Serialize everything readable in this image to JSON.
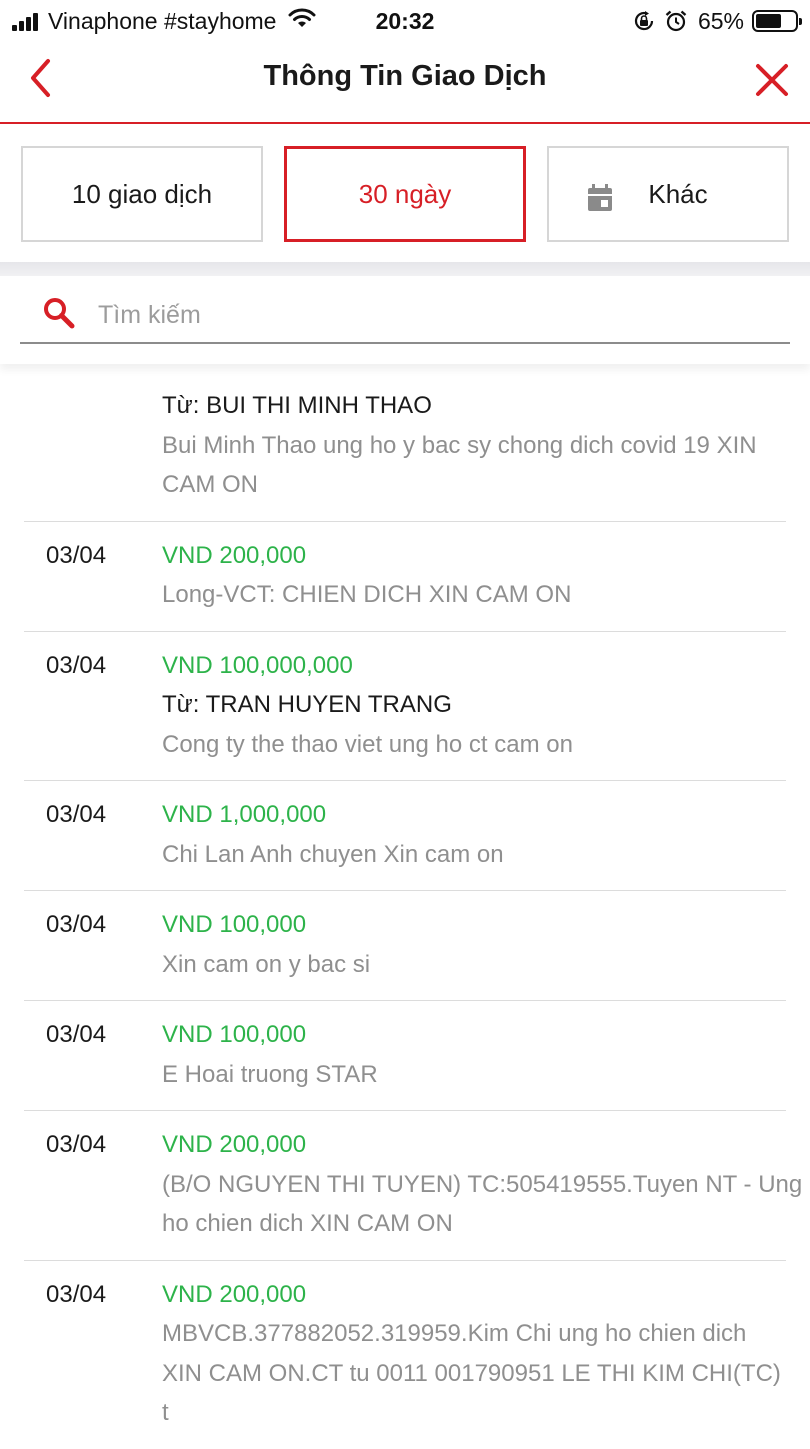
{
  "status_bar": {
    "carrier": "Vinaphone #stayhome",
    "time": "20:32",
    "battery": "65%",
    "battery_level": 0.65,
    "icons": [
      "signal-icon",
      "wifi-icon",
      "orientation-lock-icon",
      "alarm-icon",
      "battery-icon"
    ]
  },
  "header": {
    "title": "Thông Tin Giao Dịch",
    "back_icon": "chevron-left-icon",
    "close_icon": "close-icon",
    "accent_color": "#d71f26"
  },
  "filters": {
    "tab1": "10 giao dịch",
    "tab2": "30 ngày",
    "tab3": "Khác",
    "selected": "30 ngày"
  },
  "search": {
    "placeholder": "Tìm kiếm",
    "value": ""
  },
  "colors": {
    "amount": "#2db34a",
    "description": "#8f8f8f",
    "accent": "#d71f26"
  },
  "transactions": [
    {
      "date": "",
      "amount": "",
      "from": "Từ: BUI THI MINH THAO",
      "description": "Bui Minh Thao ung ho y bac sy chong dich covid 19 XIN CAM ON"
    },
    {
      "date": "03/04",
      "amount": "VND 200,000",
      "from": "",
      "description": "Long-VCT: CHIEN DICH XIN CAM ON"
    },
    {
      "date": "03/04",
      "amount": "VND 100,000,000",
      "from": "Từ: TRAN HUYEN TRANG",
      "description": "Cong ty the thao viet ung ho ct cam on"
    },
    {
      "date": "03/04",
      "amount": "VND 1,000,000",
      "from": "",
      "description": "Chi Lan Anh chuyen Xin cam on"
    },
    {
      "date": "03/04",
      "amount": "VND 100,000",
      "from": "",
      "description": "Xin cam on y bac si"
    },
    {
      "date": "03/04",
      "amount": "VND 100,000",
      "from": "",
      "description": "E Hoai truong STAR"
    },
    {
      "date": "03/04",
      "amount": "VND 200,000",
      "from": "",
      "description": "(B/O NGUYEN THI TUYEN) TC:505419555.Tuyen NT - Ung ho chien dich XIN CAM ON"
    },
    {
      "date": "03/04",
      "amount": "VND 200,000",
      "from": "",
      "description": "MBVCB.377882052.319959.Kim Chi ung ho chien dich XIN CAM ON.CT tu 0011 001790951 LE THI KIM CHI(TC) t"
    }
  ]
}
